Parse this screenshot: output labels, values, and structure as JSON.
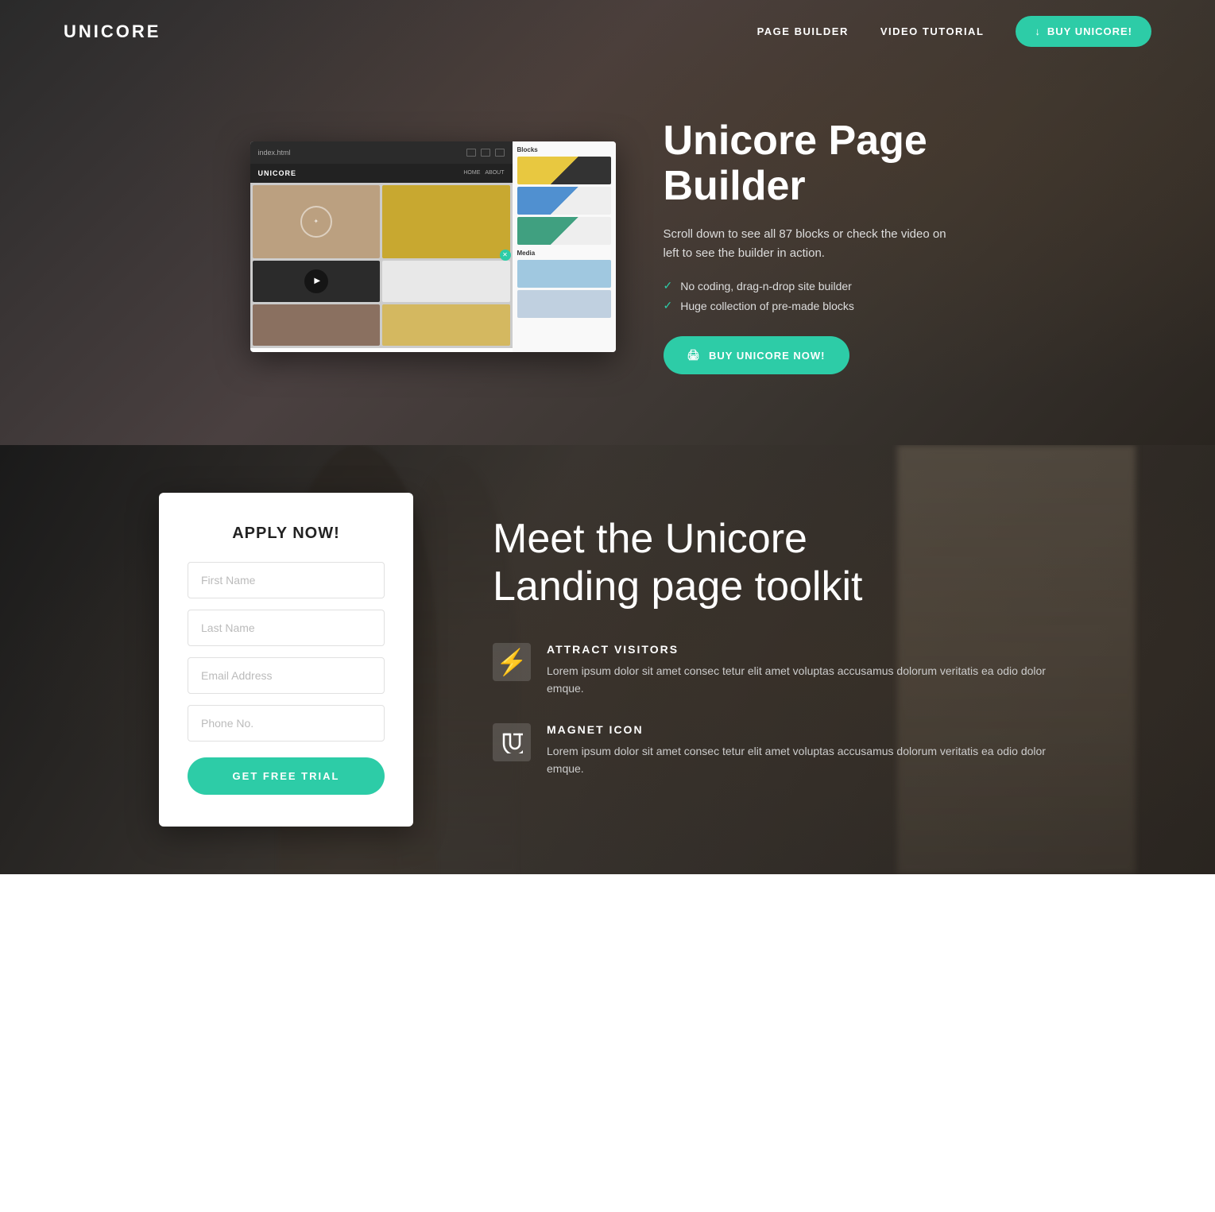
{
  "nav": {
    "logo": "UNICORE",
    "links": [
      {
        "label": "PAGE BUILDER",
        "id": "page-builder"
      },
      {
        "label": "VIDEO TUTORIAL",
        "id": "video-tutorial"
      }
    ],
    "cta_label": "BUY UNICORE!"
  },
  "hero": {
    "title": "Unicore Page Builder",
    "description": "Scroll down to see all 87 blocks or check the video on left to see the builder in action.",
    "features": [
      "No coding, drag-n-drop site builder",
      "Huge collection of pre-made blocks"
    ],
    "cta_label": "BUY UNICORE NOW!",
    "mockup": {
      "toolbar_text": "index.html",
      "header_logo": "UNICORE",
      "header_links": [
        "HOME",
        "ABOUT"
      ],
      "blocks_label": "Blocks",
      "media_label": "Media"
    }
  },
  "section2": {
    "apply_title": "APPLY NOW!",
    "form": {
      "first_name_placeholder": "First Name",
      "last_name_placeholder": "Last Name",
      "email_placeholder": "Email Address",
      "phone_placeholder": "Phone No.",
      "submit_label": "GET FREE TRIAL"
    },
    "main_title_line1": "Meet the Unicore",
    "main_title_line2": "Landing page toolkit",
    "features": [
      {
        "id": "attract",
        "icon": "lightning",
        "title": "ATTRACT VISITORS",
        "description": "Lorem ipsum dolor sit amet consec tetur elit amet voluptas accusamus dolorum veritatis ea odio dolor emque."
      },
      {
        "id": "magnet",
        "icon": "magnet",
        "title": "MAGNET ICON",
        "description": "Lorem ipsum dolor sit amet consec tetur elit amet voluptas accusamus dolorum veritatis ea odio dolor emque."
      }
    ]
  }
}
